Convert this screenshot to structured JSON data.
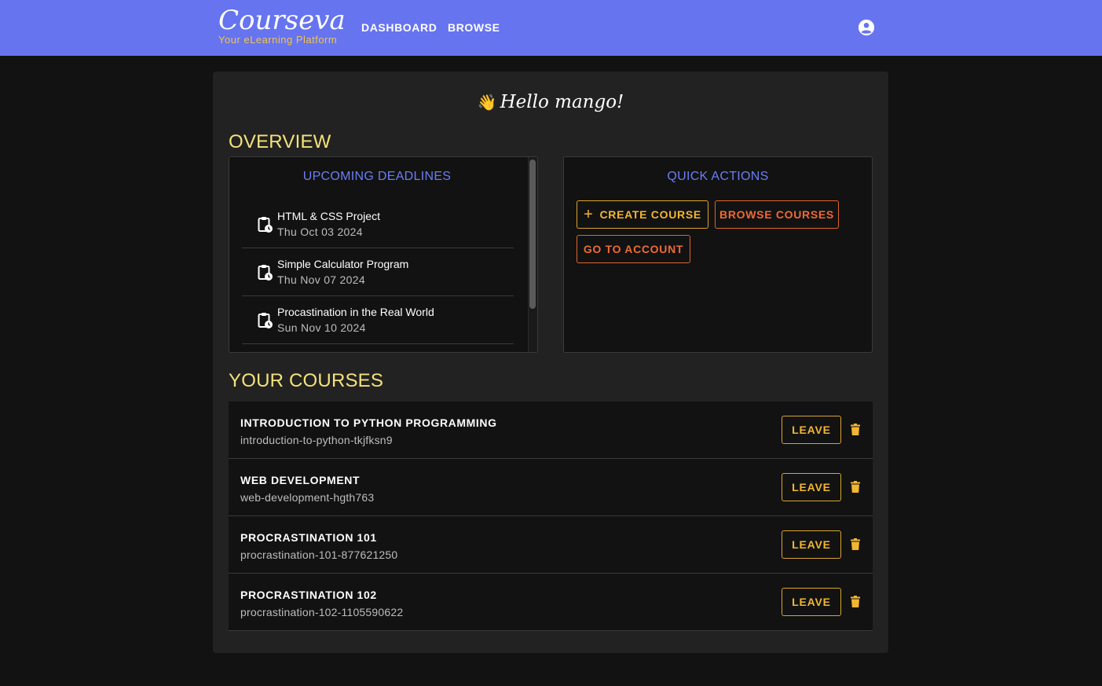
{
  "header": {
    "brand_name": "Courseva",
    "brand_tagline": "Your eLearning Platform",
    "nav": [
      "DASHBOARD",
      "BROWSE"
    ],
    "account_icon": "account-circle-icon"
  },
  "greeting": {
    "emoji": "👋",
    "text": "Hello mango!"
  },
  "overview": {
    "title": "OVERVIEW",
    "deadlines": {
      "title": "UPCOMING DEADLINES",
      "icon": "clipboard-clock-icon",
      "items": [
        {
          "name": "HTML & CSS Project",
          "date": "Thu Oct 03 2024"
        },
        {
          "name": "Simple Calculator Program",
          "date": "Thu Nov 07 2024"
        },
        {
          "name": "Procastination in the Real World",
          "date": "Sun Nov 10 2024"
        }
      ]
    },
    "quick_actions": {
      "title": "QUICK ACTIONS",
      "create_course": "CREATE COURSE",
      "browse_courses": "BROWSE COURSES",
      "go_to_account": "GO TO ACCOUNT"
    }
  },
  "courses": {
    "title": "YOUR COURSES",
    "leave_label": "LEAVE",
    "items": [
      {
        "title": "INTRODUCTION TO PYTHON PROGRAMMING",
        "slug": "introduction-to-python-tkjfksn9"
      },
      {
        "title": "WEB DEVELOPMENT",
        "slug": "web-development-hgth763"
      },
      {
        "title": "PROCRASTINATION 101",
        "slug": "procrastination-101-877621250"
      },
      {
        "title": "PROCRASTINATION 102",
        "slug": "procrastination-102-1105590622"
      }
    ]
  },
  "colors": {
    "appbar": "#6674f0",
    "accent_yellow": "#f5e27a",
    "accent_blue": "#6a7ef5",
    "leave_gold": "#f2b632",
    "action_orange": "#ef6a35"
  }
}
